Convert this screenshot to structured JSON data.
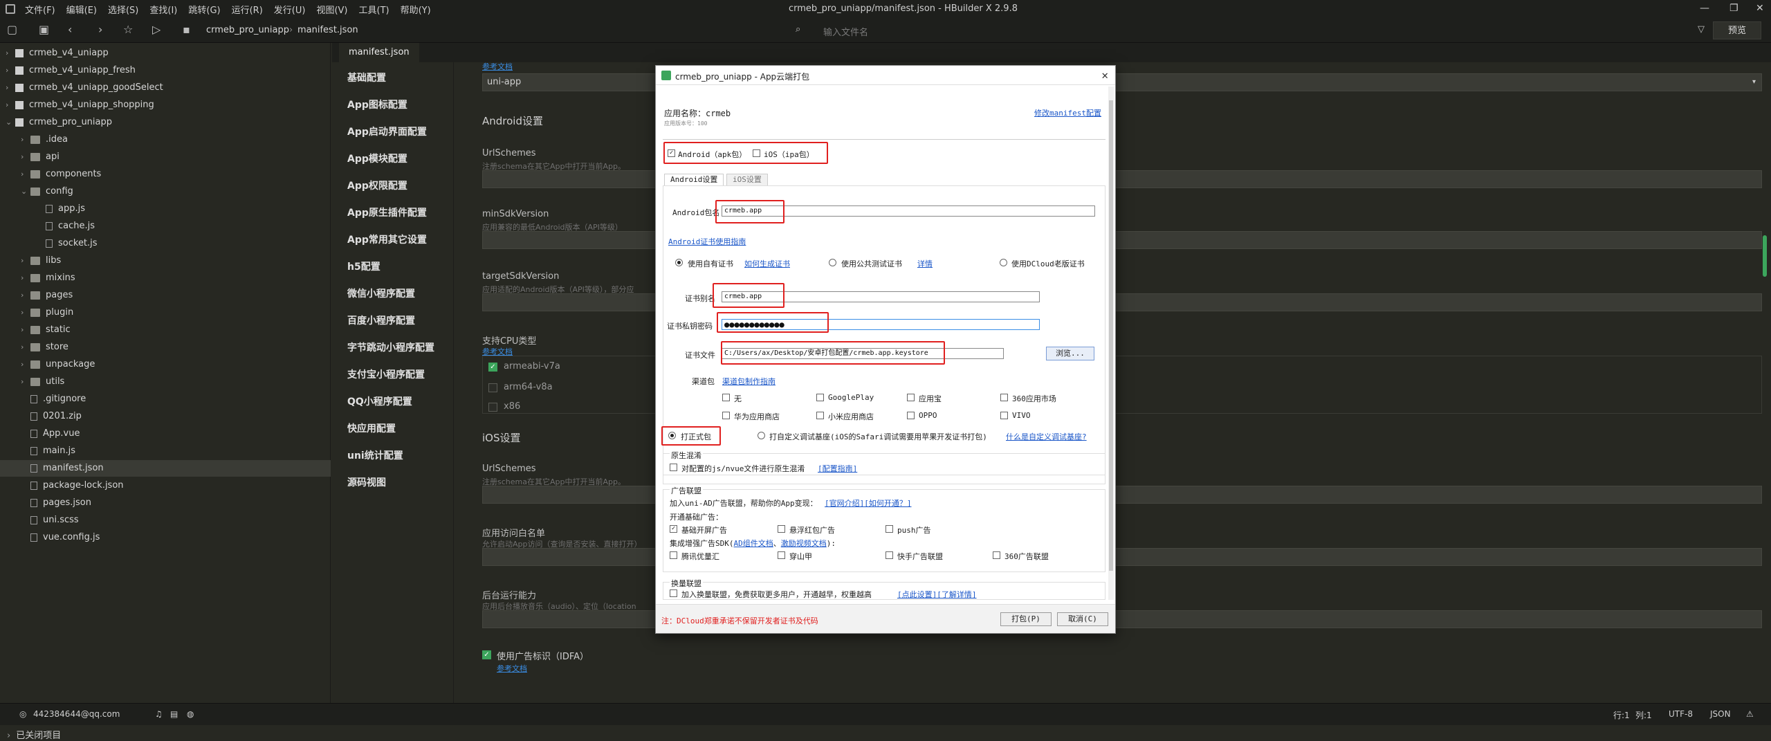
{
  "menubar": {
    "items": [
      "文件(F)",
      "编辑(E)",
      "选择(S)",
      "查找(I)",
      "跳转(G)",
      "运行(R)",
      "发行(U)",
      "视图(V)",
      "工具(T)",
      "帮助(Y)"
    ],
    "window_title": "crmeb_pro_uniapp/manifest.json - HBuilder X 2.9.8"
  },
  "toolbar": {
    "crumbs": [
      "crmeb_pro_uniapp",
      "manifest.json"
    ],
    "search_placeholder": "输入文件名",
    "preview_label": "预览"
  },
  "sidebar": {
    "items": [
      {
        "label": "crmeb_v4_uniapp",
        "level": 0,
        "type": "proj",
        "arrow": "›"
      },
      {
        "label": "crmeb_v4_uniapp_fresh",
        "level": 0,
        "type": "proj",
        "arrow": "›"
      },
      {
        "label": "crmeb_v4_uniapp_goodSelect",
        "level": 0,
        "type": "proj",
        "arrow": "›"
      },
      {
        "label": "crmeb_v4_uniapp_shopping",
        "level": 0,
        "type": "proj",
        "arrow": "›"
      },
      {
        "label": "crmeb_pro_uniapp",
        "level": 0,
        "type": "proj",
        "arrow": "⌄"
      },
      {
        "label": ".idea",
        "level": 1,
        "type": "fold",
        "arrow": "›"
      },
      {
        "label": "api",
        "level": 1,
        "type": "fold",
        "arrow": "›"
      },
      {
        "label": "components",
        "level": 1,
        "type": "fold",
        "arrow": "›"
      },
      {
        "label": "config",
        "level": 1,
        "type": "fold",
        "arrow": "⌄"
      },
      {
        "label": "app.js",
        "level": 2,
        "type": "file",
        "arrow": ""
      },
      {
        "label": "cache.js",
        "level": 2,
        "type": "file",
        "arrow": ""
      },
      {
        "label": "socket.js",
        "level": 2,
        "type": "file",
        "arrow": ""
      },
      {
        "label": "libs",
        "level": 1,
        "type": "fold",
        "arrow": "›"
      },
      {
        "label": "mixins",
        "level": 1,
        "type": "fold",
        "arrow": "›"
      },
      {
        "label": "pages",
        "level": 1,
        "type": "fold",
        "arrow": "›"
      },
      {
        "label": "plugin",
        "level": 1,
        "type": "fold",
        "arrow": "›"
      },
      {
        "label": "static",
        "level": 1,
        "type": "fold",
        "arrow": "›"
      },
      {
        "label": "store",
        "level": 1,
        "type": "fold",
        "arrow": "›"
      },
      {
        "label": "unpackage",
        "level": 1,
        "type": "fold",
        "arrow": "›"
      },
      {
        "label": "utils",
        "level": 1,
        "type": "fold",
        "arrow": "›"
      },
      {
        "label": ".gitignore",
        "level": 1,
        "type": "file",
        "arrow": ""
      },
      {
        "label": "0201.zip",
        "level": 1,
        "type": "file",
        "arrow": ""
      },
      {
        "label": "App.vue",
        "level": 1,
        "type": "file",
        "arrow": ""
      },
      {
        "label": "main.js",
        "level": 1,
        "type": "file",
        "arrow": ""
      },
      {
        "label": "manifest.json",
        "level": 1,
        "type": "file",
        "arrow": "",
        "selected": true
      },
      {
        "label": "package-lock.json",
        "level": 1,
        "type": "file",
        "arrow": ""
      },
      {
        "label": "pages.json",
        "level": 1,
        "type": "file",
        "arrow": ""
      },
      {
        "label": "uni.scss",
        "level": 1,
        "type": "file",
        "arrow": ""
      },
      {
        "label": "vue.config.js",
        "level": 1,
        "type": "file",
        "arrow": ""
      }
    ],
    "closed_projects": "已关闭项目"
  },
  "editor": {
    "tab": "manifest.json"
  },
  "settings_nav": [
    "基础配置",
    "App图标配置",
    "App启动界面配置",
    "App模块配置",
    "App权限配置",
    "App原生插件配置",
    "App常用其它设置",
    "h5配置",
    "微信小程序配置",
    "百度小程序配置",
    "字节跳动小程序配置",
    "支付宝小程序配置",
    "QQ小程序配置",
    "快应用配置",
    "uni统计配置",
    "源码视图"
  ],
  "content": {
    "ref_link": "参考文档",
    "framework_value": "uni-app",
    "android_head": "Android设置",
    "urlschemes": "UrlSchemes",
    "urlschemes_sub": "注册schema在其它App中打开当前App。",
    "minsdk": "minSdkVersion",
    "minsdk_sub": "应用兼容的最低Android版本（API等级）",
    "targetsdk": "targetSdkVersion",
    "targetsdk_sub": "应用适配的Android版本（API等级），部分应",
    "cpu": "支持CPU类型",
    "cpu_link": "参考文档",
    "cpu_items": [
      {
        "label": "armeabi-v7a",
        "checked": true
      },
      {
        "label": "arm64-v8a",
        "checked": false
      },
      {
        "label": "x86",
        "checked": false
      }
    ],
    "ios_head": "iOS设置",
    "ios_urlschemes": "UrlSchemes",
    "ios_urlschemes_sub": "注册schema在其它App中打开当前App。",
    "whitelist": "应用访问白名单",
    "whitelist_sub": "允许启动App访问（查询是否安装、直接打开）",
    "background": "后台运行能力",
    "background_sub": "应用后台播放音乐（audio）、定位（location",
    "idfa": "使用广告标识（IDFA）",
    "idfa_link": "参考文档"
  },
  "dialog": {
    "title": "crmeb_pro_uniapp - App云端打包",
    "app_name_label": "应用名称：crmeb",
    "app_version_label": "应用版本号：100",
    "modify_link": "修改manifest配置",
    "android_cb": "Android（apk包）",
    "ios_cb": "iOS（ipa包）",
    "tab_android": "Android设置",
    "tab_ios": "iOS设置",
    "pkg_label": "Android包名",
    "pkg_value": "crmeb.app",
    "cert_guide": "Android证书使用指南",
    "radio_own": "使用自有证书",
    "radio_own_link": "如何生成证书",
    "radio_public": "使用公共测试证书",
    "radio_public_link": "详情",
    "radio_dcloud": "使用DCloud老版证书",
    "alias_label": "证书别名",
    "alias_value": "crmeb.app",
    "pwd_label": "证书私钥密码",
    "pwd_value": "●●●●●●●●●●●●",
    "file_label": "证书文件",
    "file_value": "C:/Users/ax/Desktop/安卓打包配置/crmeb.app.keystore",
    "browse": "浏览...",
    "channel_label": "渠道包",
    "channel_link": "渠道包制作指南",
    "channels": [
      "无",
      "GooglePlay",
      "应用宝",
      "360应用市场",
      "华为应用商店",
      "小米应用商店",
      "OPPO",
      "VIVO"
    ],
    "formal": "打正式包",
    "custom": "打自定义调试基座(iOS的Safari调试需要用苹果开发证书打包)",
    "custom_link": "什么是自定义调试基座?",
    "native_head": "原生混淆",
    "native_cb": "对配置的js/nvue文件进行原生混淆",
    "native_link": "[配置指南]",
    "ad_head": "广告联盟",
    "ad_desc": "加入uni-AD广告联盟，帮助你的App变现：",
    "ad_link": "[官网介绍][如何开通？]",
    "ad_basic": "开通基础广告：",
    "ad_basic_items": [
      {
        "label": "基础开屏广告",
        "checked": true
      },
      {
        "label": "悬浮红包广告",
        "checked": false
      },
      {
        "label": "push广告",
        "checked": false
      }
    ],
    "ad_sdk": "集成增强广告SDK(",
    "ad_sdk_link1": "AD组件文档",
    "ad_sdk_link2": "激励视频文档",
    "ad_sdk_tail": "):",
    "ad_sdk_items": [
      "腾讯优量汇",
      "穿山甲",
      "快手广告联盟",
      "360广告联盟"
    ],
    "swap_head": "换量联盟",
    "swap_cb": "加入换量联盟，免费获取更多用户，开通越早，权重越高",
    "swap_link": "[点此设置][了解详情]",
    "note": "注：DCloud郑重承诺不保留开发者证书及代码",
    "pack_btn": "打包(P)",
    "cancel_btn": "取消(C)"
  },
  "status": {
    "email": "442384644@qq.com",
    "pos": "行:1",
    "col": "列:1",
    "enc": "UTF-8",
    "lang": "JSON"
  }
}
